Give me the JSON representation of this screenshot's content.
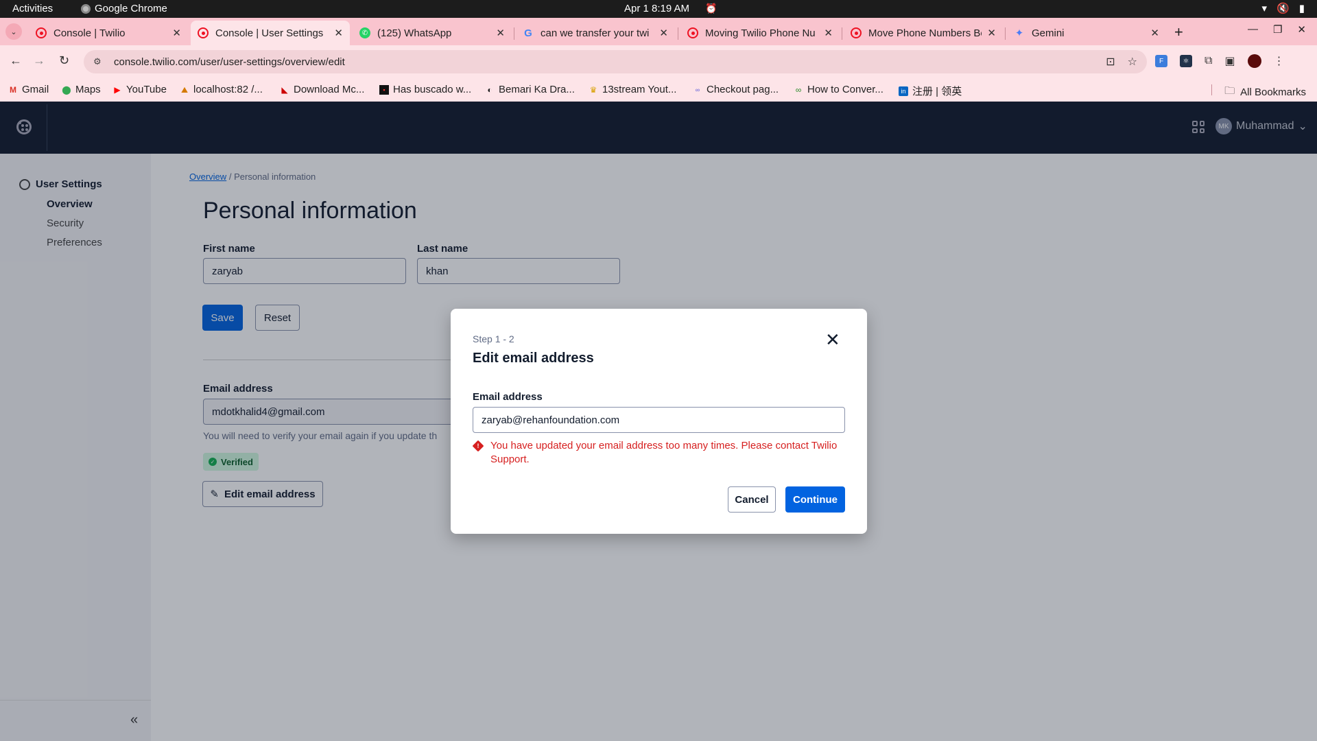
{
  "os": {
    "activities": "Activities",
    "app_name": "Google Chrome",
    "clock": "Apr 1  8:19 AM"
  },
  "tabs": [
    {
      "title": "Console | Twilio",
      "icon": "twilio-icon"
    },
    {
      "title": "Console | User Settings",
      "icon": "twilio-icon",
      "active": true
    },
    {
      "title": "(125) WhatsApp",
      "icon": "whatsapp-icon"
    },
    {
      "title": "can we transfer your twi",
      "icon": "google-icon"
    },
    {
      "title": "Moving Twilio Phone Nu",
      "icon": "twilio-icon"
    },
    {
      "title": "Move Phone Numbers Be",
      "icon": "twilio-icon"
    },
    {
      "title": "Gemini",
      "icon": "gemini-icon"
    }
  ],
  "address_bar": {
    "url": "console.twilio.com/user/user-settings/overview/edit"
  },
  "bookmarks": [
    {
      "label": "Gmail",
      "icon": "gmail-icon"
    },
    {
      "label": "Maps",
      "icon": "maps-icon"
    },
    {
      "label": "YouTube",
      "icon": "youtube-icon"
    },
    {
      "label": "localhost:82 /...",
      "icon": "localhost-icon"
    },
    {
      "label": "Download Mc...",
      "icon": "mcafee-icon"
    },
    {
      "label": "Has buscado w...",
      "icon": "bookmark-icon"
    },
    {
      "label": "Bemari Ka Dra...",
      "icon": "bookmark-icon"
    },
    {
      "label": "13stream Yout...",
      "icon": "bookmark-icon"
    },
    {
      "label": "Checkout pag...",
      "icon": "bookmark-icon"
    },
    {
      "label": "How to Conver...",
      "icon": "bookmark-icon"
    },
    {
      "label": "注册 | 领英",
      "icon": "linkedin-icon"
    }
  ],
  "all_bookmarks": "All Bookmarks",
  "header": {
    "user_initials": "MK",
    "user_name": "Muhammad"
  },
  "sidebar": {
    "group_label": "User Settings",
    "items": [
      {
        "label": "Overview",
        "active": true
      },
      {
        "label": "Security"
      },
      {
        "label": "Preferences"
      }
    ]
  },
  "breadcrumb": {
    "link": "Overview",
    "separator": "/",
    "current": "Personal information"
  },
  "page": {
    "title": "Personal information",
    "first_name_label": "First name",
    "first_name_value": "zaryab",
    "last_name_label": "Last name",
    "last_name_value": "khan",
    "save_label": "Save",
    "reset_label": "Reset",
    "email_label": "Email address",
    "email_value": "mdotkhalid4@gmail.com",
    "email_help": "You will need to verify your email again if you update th",
    "verified_label": "Verified",
    "edit_email_label": "Edit email address"
  },
  "modal": {
    "step": "Step 1 - 2",
    "title": "Edit email address",
    "field_label": "Email address",
    "field_value": "zaryab@rehanfoundation.com",
    "error": "You have updated your email address too many times. Please contact Twilio Support.",
    "cancel_label": "Cancel",
    "continue_label": "Continue"
  },
  "colors": {
    "tab_strip": "#f9c4ce",
    "twilio_header": "#121c2d",
    "primary_button": "#0263e0",
    "error": "#d61f1f",
    "verified_badge": "#d1fae0"
  }
}
